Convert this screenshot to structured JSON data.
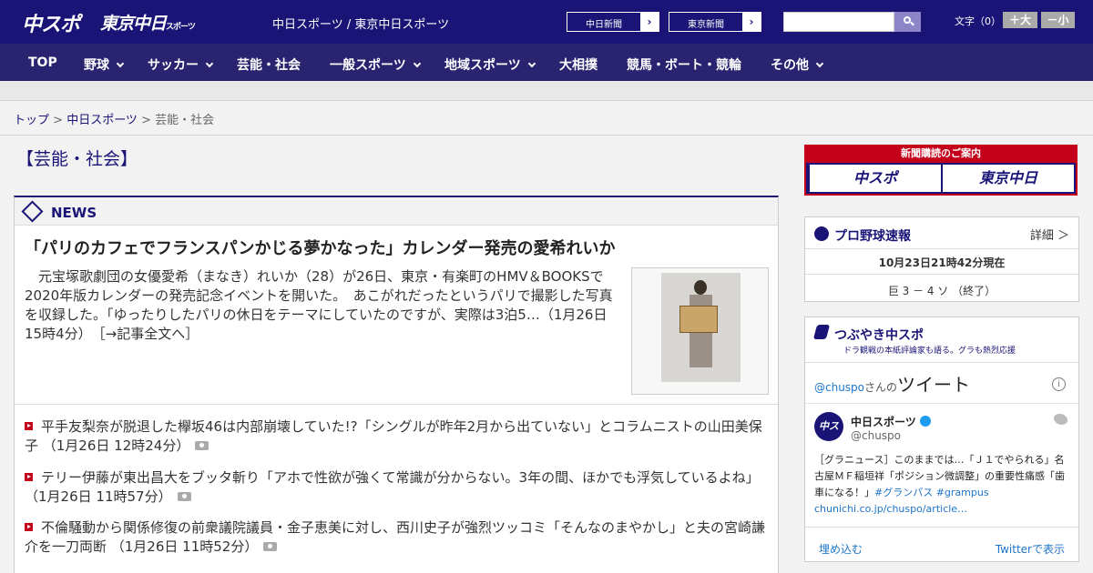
{
  "header": {
    "logo_chuspo": "中スポ",
    "logo_tokyo": "東京中日",
    "logo_tokyo_small": "スポーツ",
    "site_name": "中日スポーツ / 東京中日スポーツ",
    "pill1": "中日新聞",
    "pill2": "東京新聞",
    "pill_arrow": "›",
    "font_label": "文字（0）",
    "font_larger": "＋大",
    "font_smaller": "－小"
  },
  "nav": [
    {
      "label": "TOP"
    },
    {
      "label": "野球"
    },
    {
      "label": "サッカー"
    },
    {
      "label": "芸能・社会"
    },
    {
      "label": "一般スポーツ"
    },
    {
      "label": "地域スポーツ"
    },
    {
      "label": "大相撲"
    },
    {
      "label": "競馬・ボート・競輪"
    },
    {
      "label": "その他"
    }
  ],
  "breadcrumb": {
    "top": "トップ",
    "sep": " > ",
    "parent": "中日スポーツ",
    "current": "芸能・社会"
  },
  "category_title": "【芸能・社会】",
  "news": {
    "label": "NEWS",
    "lead_title": "「パリのカフェでフランスパンかじる夢かなった」カレンダー発売の愛希れいか",
    "lead_text": "　元宝塚歌劇団の女優愛希（まなき）れいか（28）が26日、東京・有楽町のHMV＆BOOKSで2020年版カレンダーの発売記念イベントを開いた。　あこがれだったというパリで撮影した写真を収録した。「ゆったりしたパリの休日をテーマにしていたのですが、実際は3泊5…（1月26日 15時4分）",
    "lead_more": "［→記事全文へ］",
    "items": [
      {
        "text": "平手友梨奈が脱退した欅坂46は内部崩壊していた!?「シングルが昨年2月から出ていない」とコラムニストの山田美保子 （1月26日 12時24分）"
      },
      {
        "text": "テリー伊藤が東出昌大をブッタ斬り「アホで性欲が強くて常識が分からない。3年の間、ほかでも浮気しているよね」 （1月26日 11時57分）"
      },
      {
        "text": "不倫騒動から関係修復の前衆議院議員・金子恵美に対し、西川史子が強烈ツッコミ「そんなのまやかし」と夫の宮崎謙介を一刀両断 （1月26日 11時52分）"
      }
    ]
  },
  "sidebar": {
    "ad_top": "新聞購読のご案内",
    "ad_btn1": "中スポ",
    "ad_btn2": "東京中日",
    "baseball": {
      "title": "プロ野球速報",
      "detail": "詳細 ＞",
      "time": "10月23日21時42分現在",
      "score": "巨 3 － 4 ソ （終了）"
    },
    "twitter": {
      "title": "つぶやき中スポ",
      "subtitle": "ドラ観戦の本紙評論家も語る。グラも熱烈応援",
      "handle": "@chuspo",
      "san": "さんの",
      "tweet_word": "ツイート",
      "info": "i",
      "avatar": "中スポ",
      "name": "中日スポーツ",
      "at": "@chuspo",
      "text": "［グラニュース］このままでは…「Ｊ１でやられる」名古屋ＭＦ稲垣祥「ポジション微調整」の重要性痛感「歯車になる！」",
      "tags": "#グランパス #grampus",
      "url": "chunichi.co.jp/chuspo/article…",
      "embed": "埋め込む",
      "view": "Twitterで表示"
    }
  }
}
